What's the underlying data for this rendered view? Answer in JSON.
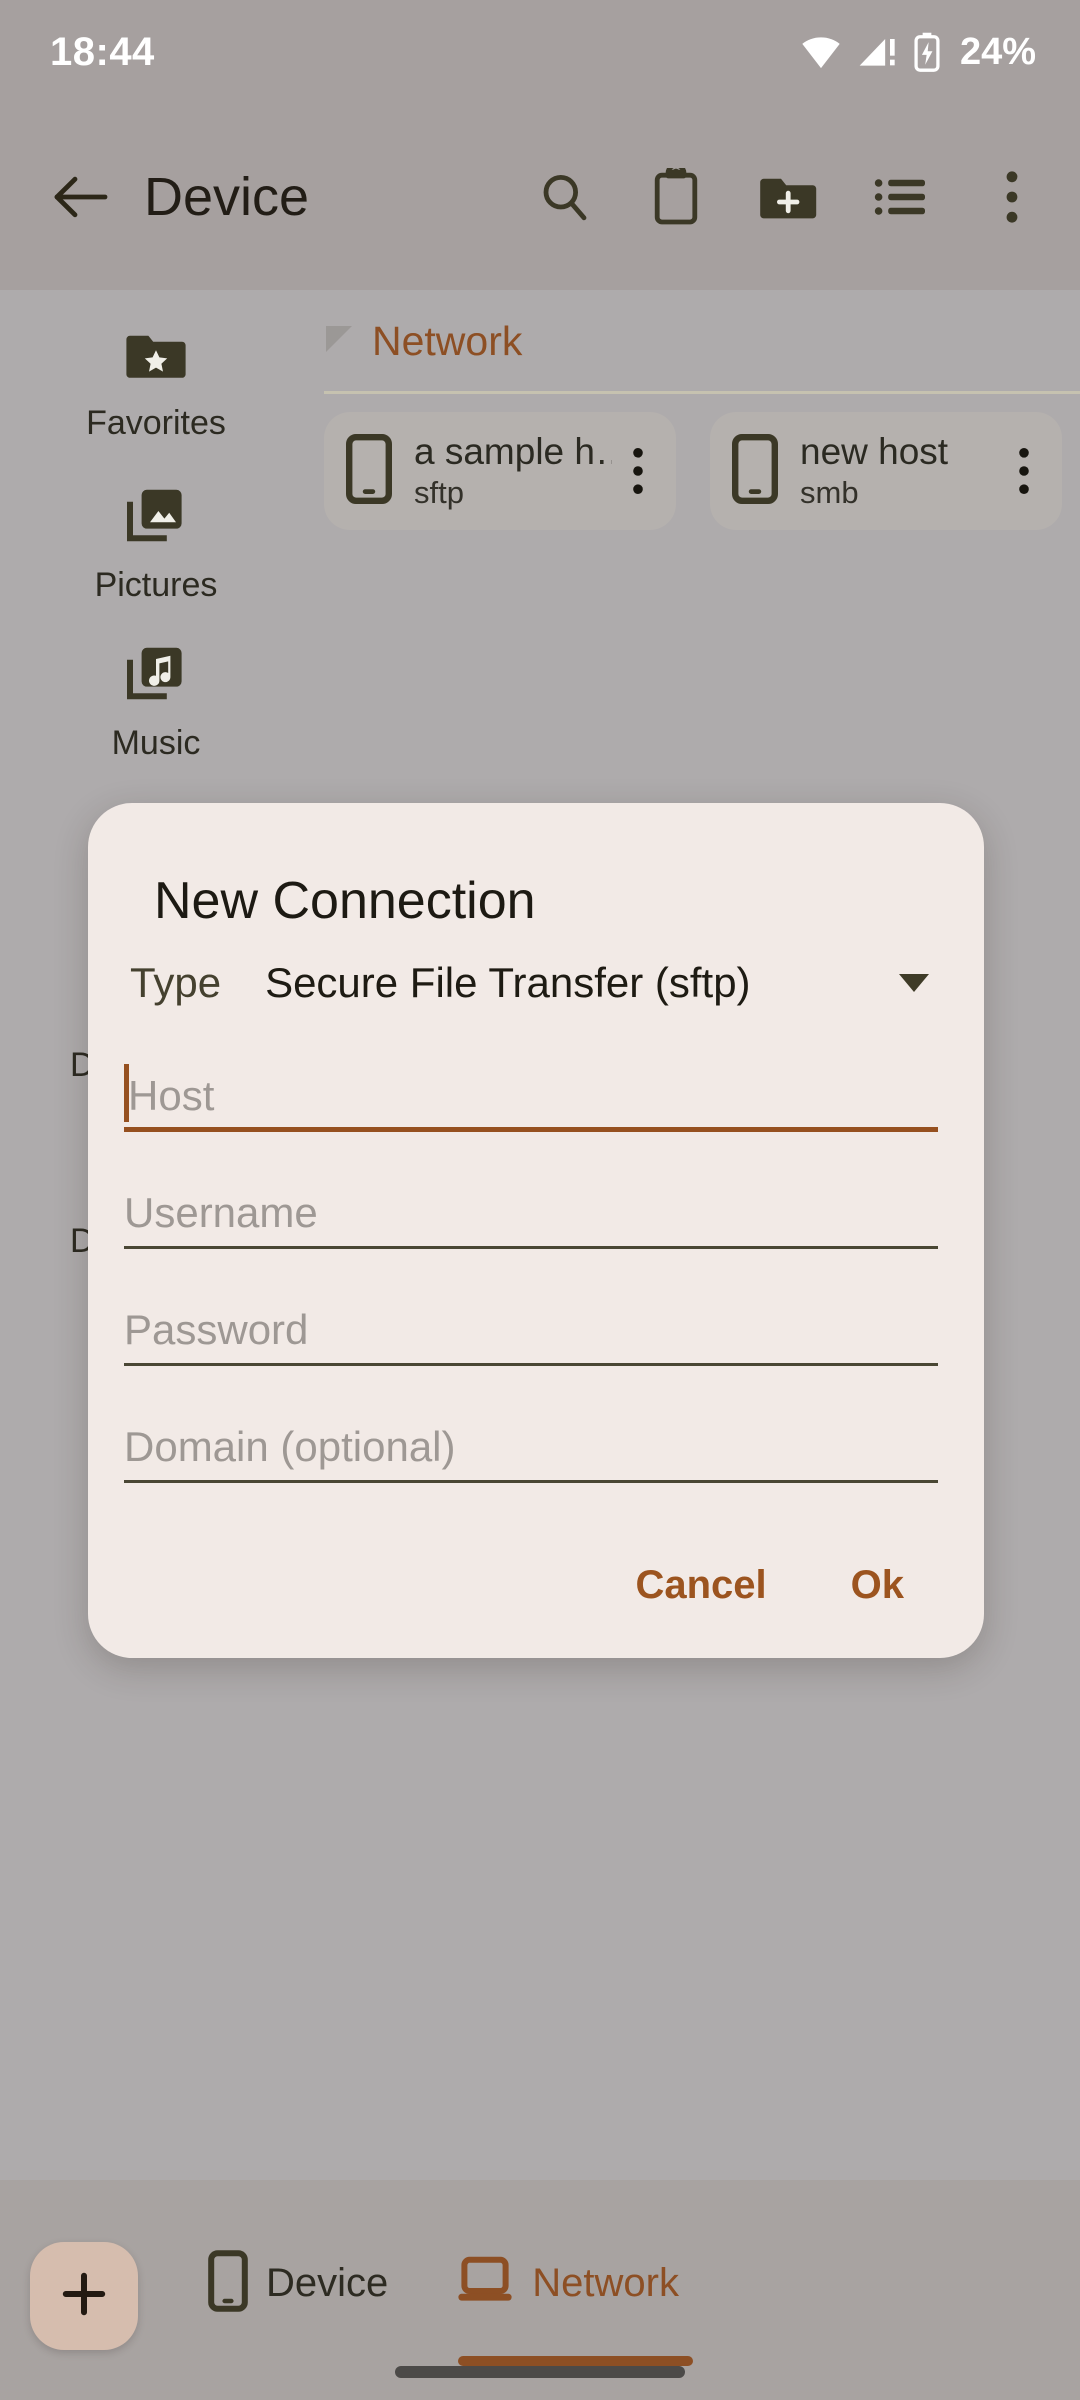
{
  "statusbar": {
    "time": "18:44",
    "battery_percent": "24%",
    "icons": [
      "wifi-icon",
      "cellular-signal-icon",
      "battery-charging-icon"
    ]
  },
  "appbar": {
    "back_icon": "arrow-back-icon",
    "title": "Device",
    "actions": [
      {
        "name": "search-icon",
        "label": "Search"
      },
      {
        "name": "clipboard-icon",
        "label": "Clipboard"
      },
      {
        "name": "new-folder-icon",
        "label": "New folder"
      },
      {
        "name": "list-view-icon",
        "label": "View mode"
      },
      {
        "name": "overflow-menu-icon",
        "label": "More options"
      }
    ]
  },
  "shortcuts": [
    {
      "label": "Favorites",
      "icon": "folder-star-icon"
    },
    {
      "label": "Pictures",
      "icon": "photo-library-icon"
    },
    {
      "label": "Music",
      "icon": "music-library-icon"
    }
  ],
  "background_fragments": [
    "D",
    "D"
  ],
  "network_section": {
    "title": "Network",
    "collapse_icon": "collapse-triangle-icon",
    "hosts": [
      {
        "name": "a sample h…",
        "protocol": "sftp",
        "icon": "device-phone-icon",
        "menu_icon": "overflow-menu-icon"
      },
      {
        "name": "new host",
        "protocol": "smb",
        "icon": "device-phone-icon",
        "menu_icon": "overflow-menu-icon"
      }
    ]
  },
  "dialog": {
    "title": "New Connection",
    "type_label": "Type",
    "type_value": "Secure File Transfer (sftp)",
    "type_caret_icon": "chevron-down-icon",
    "fields": [
      {
        "name": "host",
        "placeholder": "Host",
        "value": "",
        "focused": true
      },
      {
        "name": "username",
        "placeholder": "Username",
        "value": "",
        "focused": false
      },
      {
        "name": "password",
        "placeholder": "Password",
        "value": "",
        "focused": false
      },
      {
        "name": "domain",
        "placeholder": "Domain (optional)",
        "value": "",
        "focused": false
      }
    ],
    "cancel_label": "Cancel",
    "ok_label": "Ok"
  },
  "bottombar": {
    "fab_icon": "plus-icon",
    "tabs": [
      {
        "label": "Device",
        "icon": "phone-icon",
        "active": false
      },
      {
        "label": "Network",
        "icon": "computer-icon",
        "active": true
      }
    ]
  },
  "colors": {
    "accent_brown": "#8d4f24",
    "dialog_surface": "#f2eae6",
    "app_background": "#aeabac",
    "appbar_background": "#a6a09f",
    "icon_dark": "#3b3826",
    "fab_background": "#d6bdae"
  }
}
